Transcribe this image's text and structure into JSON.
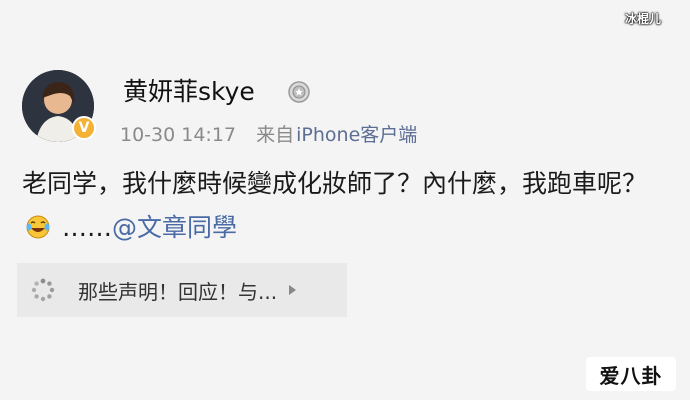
{
  "watermark_top": "冰棍儿",
  "post": {
    "username": "黄妍菲skye",
    "timestamp": "10-30 14:17",
    "source_prefix": "来自",
    "source_name": "iPhone客户端",
    "text_main": "老同学，我什麼時候變成化妝師了？內什麼，我跑車呢？",
    "text_ellipsis": "……",
    "mention": "@文章同學",
    "verified_mark": "V"
  },
  "link_card": {
    "label": "那些声明！回应！与..."
  },
  "watermark_logo": "爱八卦",
  "colors": {
    "background": "#f4f4f4",
    "mention": "#4a6aa5",
    "verified": "#f3b233",
    "meta_gray": "#8a8a8a"
  },
  "icons": {
    "avatar": "avatar",
    "verified": "verified-badge-icon",
    "medal": "medal-icon",
    "emoji": "laughing-crying-emoji-icon",
    "card": "loading-spinner-icon",
    "arrow": "chevron-right-icon"
  }
}
